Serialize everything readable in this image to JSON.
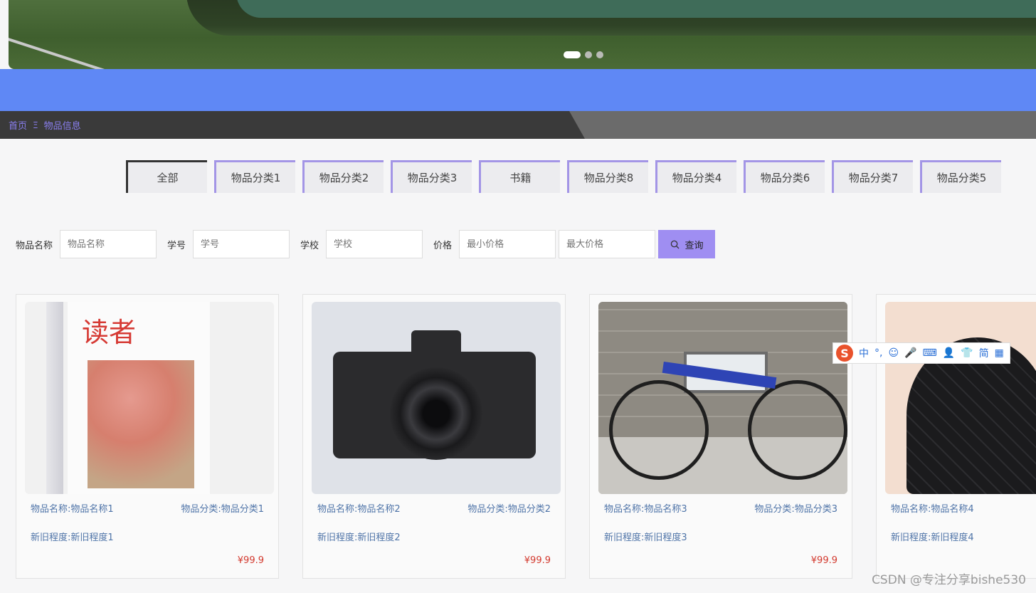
{
  "breadcrumb": {
    "home": "首页",
    "separator": "Ξ",
    "current": "物品信息"
  },
  "banner": {
    "slides": 3,
    "active_slide": 1
  },
  "tabs": [
    "全部",
    "物品分类1",
    "物品分类2",
    "物品分类3",
    "书籍",
    "物品分类8",
    "物品分类4",
    "物品分类6",
    "物品分类7",
    "物品分类5"
  ],
  "search": {
    "name_label": "物品名称",
    "name_placeholder": "物品名称",
    "id_label": "学号",
    "id_placeholder": "学号",
    "school_label": "学校",
    "school_placeholder": "学校",
    "price_label": "价格",
    "min_placeholder": "最小价格",
    "max_placeholder": "最大价格",
    "button": "查询"
  },
  "items": [
    {
      "name": "物品名称:物品名称1",
      "category": "物品分类:物品分类1",
      "condition": "新旧程度:新旧程度1",
      "price": "¥99.9",
      "image_text": "读者"
    },
    {
      "name": "物品名称:物品名称2",
      "category": "物品分类:物品分类2",
      "condition": "新旧程度:新旧程度2",
      "price": "¥99.9"
    },
    {
      "name": "物品名称:物品名称3",
      "category": "物品分类:物品分类3",
      "condition": "新旧程度:新旧程度3",
      "price": "¥99.9"
    },
    {
      "name": "物品名称:物品名称4",
      "category": "",
      "condition": "新旧程度:新旧程度4",
      "price": ""
    }
  ],
  "ime": {
    "logo": "S",
    "items": [
      "中",
      "°,",
      "☺",
      "🎤",
      "⌨",
      "👤",
      "👕",
      "简",
      "▦"
    ]
  },
  "watermark": "CSDN @专注分享bishe530",
  "colors": {
    "accent": "#9f8ef2",
    "blue_strip": "#5f88f5",
    "link": "#4f74a8",
    "price": "#d33a2f"
  }
}
